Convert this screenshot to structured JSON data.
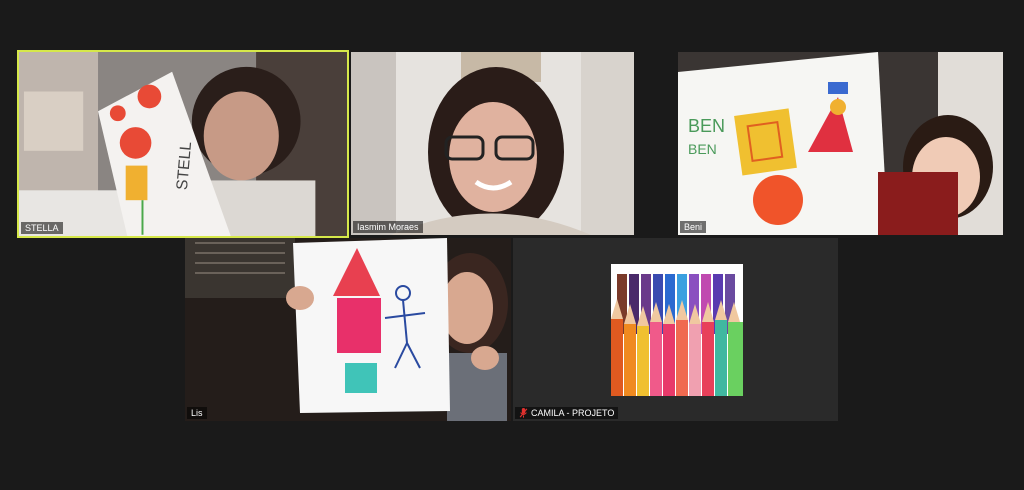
{
  "participants": [
    {
      "name": "STELLA",
      "active": true,
      "muted": false
    },
    {
      "name": "Iasmim Moraes",
      "active": false,
      "muted": false
    },
    {
      "name": "Beni",
      "active": false,
      "muted": false
    },
    {
      "name": "Lis",
      "active": false,
      "muted": false
    },
    {
      "name": "CAMILA - PROJETO",
      "active": false,
      "muted": true
    }
  ],
  "drawings": {
    "stella_paper_text": "STELL",
    "beni_paper_text_1": "BEN",
    "beni_paper_text_2": "BEN"
  },
  "colors": {
    "active_speaker_border": "#d6e84a",
    "muted_icon": "#e0302e",
    "background": "#1a1a1a"
  },
  "icons": {
    "muted": "mic-muted-icon"
  }
}
